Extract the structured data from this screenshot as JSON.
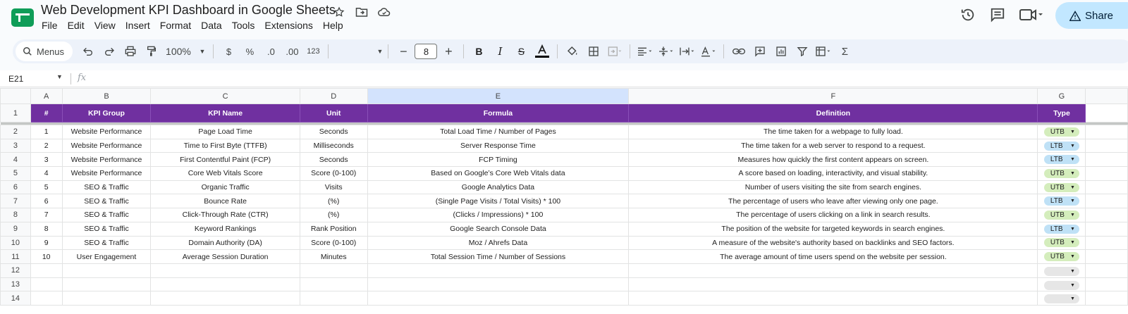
{
  "app": {
    "title": "Web Development KPI Dashboard in Google Sheets",
    "menu": [
      "File",
      "Edit",
      "View",
      "Insert",
      "Format",
      "Data",
      "Tools",
      "Extensions",
      "Help"
    ],
    "share_label": "Share"
  },
  "toolbar": {
    "search_label": "Menus",
    "zoom": "100%",
    "currency": "$",
    "percent": "%",
    "dec_decrease": ".0",
    "dec_increase": ".00",
    "number_format": "123",
    "font_size": "8"
  },
  "formula_bar": {
    "cell_ref": "E21",
    "fx": "fx",
    "content": ""
  },
  "sheet": {
    "columns": [
      "A",
      "B",
      "C",
      "D",
      "E",
      "F",
      "G"
    ],
    "header": [
      "#",
      "KPI Group",
      "KPI Name",
      "Unit",
      "Formula",
      "Definition",
      "Type"
    ],
    "rows": [
      {
        "n": "2",
        "cells": [
          "1",
          "Website Performance",
          "Page Load Time",
          "Seconds",
          "Total Load Time / Number of Pages",
          "The time taken for a webpage to fully load.",
          "UTB"
        ]
      },
      {
        "n": "3",
        "cells": [
          "2",
          "Website Performance",
          "Time to First Byte (TTFB)",
          "Milliseconds",
          "Server Response Time",
          "The time taken for a web server to respond to a request.",
          "LTB"
        ]
      },
      {
        "n": "4",
        "cells": [
          "3",
          "Website Performance",
          "First Contentful Paint (FCP)",
          "Seconds",
          "FCP Timing",
          "Measures how quickly the first content appears on screen.",
          "LTB"
        ]
      },
      {
        "n": "5",
        "cells": [
          "4",
          "Website Performance",
          "Core Web Vitals Score",
          "Score (0-100)",
          "Based on Google’s Core Web Vitals data",
          "A score based on loading, interactivity, and visual stability.",
          "UTB"
        ]
      },
      {
        "n": "6",
        "cells": [
          "5",
          "SEO & Traffic",
          "Organic Traffic",
          "Visits",
          "Google Analytics Data",
          "Number of users visiting the site from search engines.",
          "UTB"
        ]
      },
      {
        "n": "7",
        "cells": [
          "6",
          "SEO & Traffic",
          "Bounce Rate",
          "(%)",
          "(Single Page Visits / Total Visits) * 100",
          "The percentage of users who leave after viewing only one page.",
          "LTB"
        ]
      },
      {
        "n": "8",
        "cells": [
          "7",
          "SEO & Traffic",
          "Click-Through Rate (CTR)",
          "(%)",
          "(Clicks / Impressions) * 100",
          "The percentage of users clicking on a link in search results.",
          "UTB"
        ]
      },
      {
        "n": "9",
        "cells": [
          "8",
          "SEO & Traffic",
          "Keyword Rankings",
          "Rank Position",
          "Google Search Console Data",
          "The position of the website for targeted keywords in search engines.",
          "LTB"
        ]
      },
      {
        "n": "10",
        "cells": [
          "9",
          "SEO & Traffic",
          "Domain Authority (DA)",
          "Score (0-100)",
          "Moz / Ahrefs Data",
          "A measure of the website's authority based on backlinks and SEO factors.",
          "UTB"
        ]
      },
      {
        "n": "11",
        "cells": [
          "10",
          "User Engagement",
          "Average Session Duration",
          "Minutes",
          "Total Session Time / Number of Sessions",
          "The average amount of time users spend on the website per session.",
          "UTB"
        ]
      },
      {
        "n": "12",
        "cells": [
          "",
          "",
          "",
          "",
          "",
          "",
          ""
        ]
      },
      {
        "n": "13",
        "cells": [
          "",
          "",
          "",
          "",
          "",
          "",
          ""
        ]
      },
      {
        "n": "14",
        "cells": [
          "",
          "",
          "",
          "",
          "",
          "",
          ""
        ]
      }
    ]
  },
  "colors": {
    "header_bg": "#7030a0",
    "utb_chip": "#d4edbc",
    "ltb_chip": "#bfe1f6",
    "selected_col": "#d3e3fd",
    "share_bg": "#c2e7ff"
  },
  "icons": [
    "sheets-logo-icon",
    "star-icon",
    "move-to-folder-icon",
    "cloud-status-icon",
    "history-icon",
    "comment-icon",
    "meet-icon",
    "lock-warning-icon",
    "search-icon",
    "undo-icon",
    "redo-icon",
    "print-icon",
    "paint-format-icon",
    "bold-icon",
    "italic-icon",
    "strikethrough-icon",
    "text-color-icon",
    "fill-color-icon",
    "borders-icon",
    "merge-icon",
    "align-icon",
    "valign-icon",
    "wrap-icon",
    "rotate-icon",
    "link-icon",
    "insert-comment-icon",
    "chart-icon",
    "filter-icon",
    "filter-views-icon",
    "functions-icon"
  ]
}
